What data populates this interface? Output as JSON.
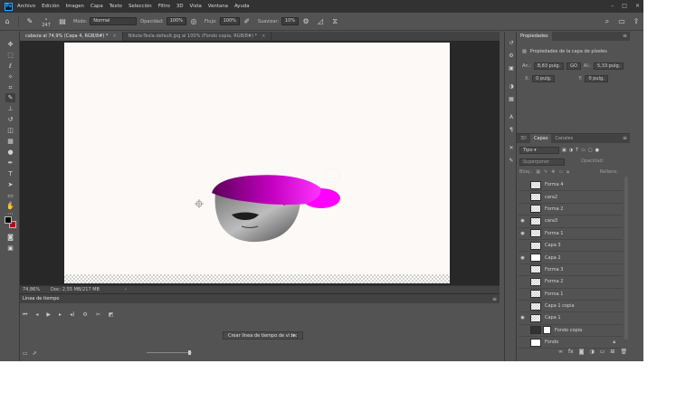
{
  "menubar": {
    "logo": "Ps",
    "items": [
      "Archivo",
      "Edición",
      "Imagen",
      "Capa",
      "Texto",
      "Selección",
      "Filtro",
      "3D",
      "Vista",
      "Ventana",
      "Ayuda"
    ],
    "window_controls": [
      "–",
      "□",
      "×"
    ]
  },
  "options": {
    "brush_size": "247",
    "mode_label": "Modo:",
    "mode_value": "Normal",
    "opacity_label": "Opacidad:",
    "opacity_value": "100%",
    "flow_label": "Flujo:",
    "flow_value": "100%",
    "smooth_label": "Suavizar:",
    "smooth_value": "10%"
  },
  "tabs": [
    {
      "label": "cabeza al 74,9% (Capa 4, RGB/8#) *",
      "close": "×"
    },
    {
      "label": "Nikola-Tesla-default.jpg al 100% (Fondo copia, RGB/8#) *",
      "close": "×"
    }
  ],
  "status": {
    "zoom": "74,86%",
    "doc": "Doc: 2,55 MB/217 MB"
  },
  "timeline": {
    "title": "Línea de tiempo",
    "create_button": "Crear línea de tiempo de vídeo"
  },
  "properties": {
    "tab": "Propiedades",
    "title": "Propiedades de la capa de píxeles",
    "w_label": "An.:",
    "w_value": "8,83 pulg.",
    "link": "GO",
    "h_label": "Al.:",
    "h_value": "5,33 pulg.",
    "x_label": "X:",
    "x_value": "0 pulg.",
    "y_label": "Y:",
    "y_value": "0 pulg."
  },
  "layers_panel": {
    "tabs": [
      "3D",
      "Capas",
      "Canales"
    ],
    "filter_label": "Tipo",
    "blend_mode": "Superponer",
    "opacity_label": "Opacidad:",
    "lock_label": "Bloq.:",
    "fill_label": "Relleno:",
    "layers": [
      {
        "name": "Forma 4",
        "visible": false,
        "thumb": "checker"
      },
      {
        "name": "cara2",
        "visible": false,
        "thumb": "checker"
      },
      {
        "name": "Forma 2",
        "visible": false,
        "thumb": "checker"
      },
      {
        "name": "cara3",
        "visible": true,
        "thumb": "checker"
      },
      {
        "name": "Forma 1",
        "visible": true,
        "thumb": "checker"
      },
      {
        "name": "Capa 3",
        "visible": false,
        "thumb": "checker"
      },
      {
        "name": "Capa 2",
        "visible": true,
        "thumb": "white"
      },
      {
        "name": "Forma 3",
        "visible": false,
        "thumb": "checker"
      },
      {
        "name": "Forma 2",
        "visible": false,
        "thumb": "checker"
      },
      {
        "name": "Forma 1",
        "visible": false,
        "thumb": "checker"
      },
      {
        "name": "Capa 1 copia",
        "visible": false,
        "thumb": "checker"
      },
      {
        "name": "Capa 1",
        "visible": true,
        "thumb": "checker"
      },
      {
        "name": "Fondo copia",
        "visible": false,
        "thumb": "dark",
        "mask": true
      },
      {
        "name": "Fondo",
        "visible": false,
        "thumb": "white",
        "locked": true
      }
    ]
  },
  "colors": {
    "hat_pink": "#ff00ff",
    "foreground": "#000000",
    "background": "#c10020"
  }
}
